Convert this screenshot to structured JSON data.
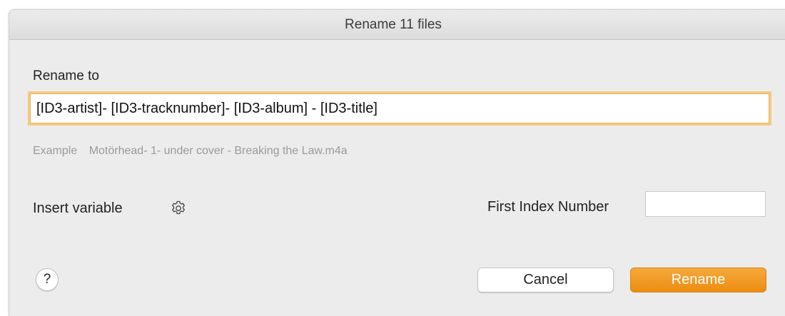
{
  "window": {
    "title": "Rename 11 files"
  },
  "form": {
    "rename_label": "Rename to",
    "rename_value": "[ID3-artist]- [ID3-tracknumber]- [ID3-album] - [ID3-title]",
    "example_label": "Example",
    "example_value": "Motörhead- 1- under cover - Breaking the Law.m4a",
    "insert_variable_label": "Insert variable",
    "insert_variable_icon": "gear-icon",
    "first_index_label": "First Index Number",
    "first_index_value": ""
  },
  "buttons": {
    "help_label": "?",
    "cancel_label": "Cancel",
    "rename_label": "Rename"
  },
  "colors": {
    "accent": "#ec8d12",
    "focus_ring": "#f5c983"
  }
}
